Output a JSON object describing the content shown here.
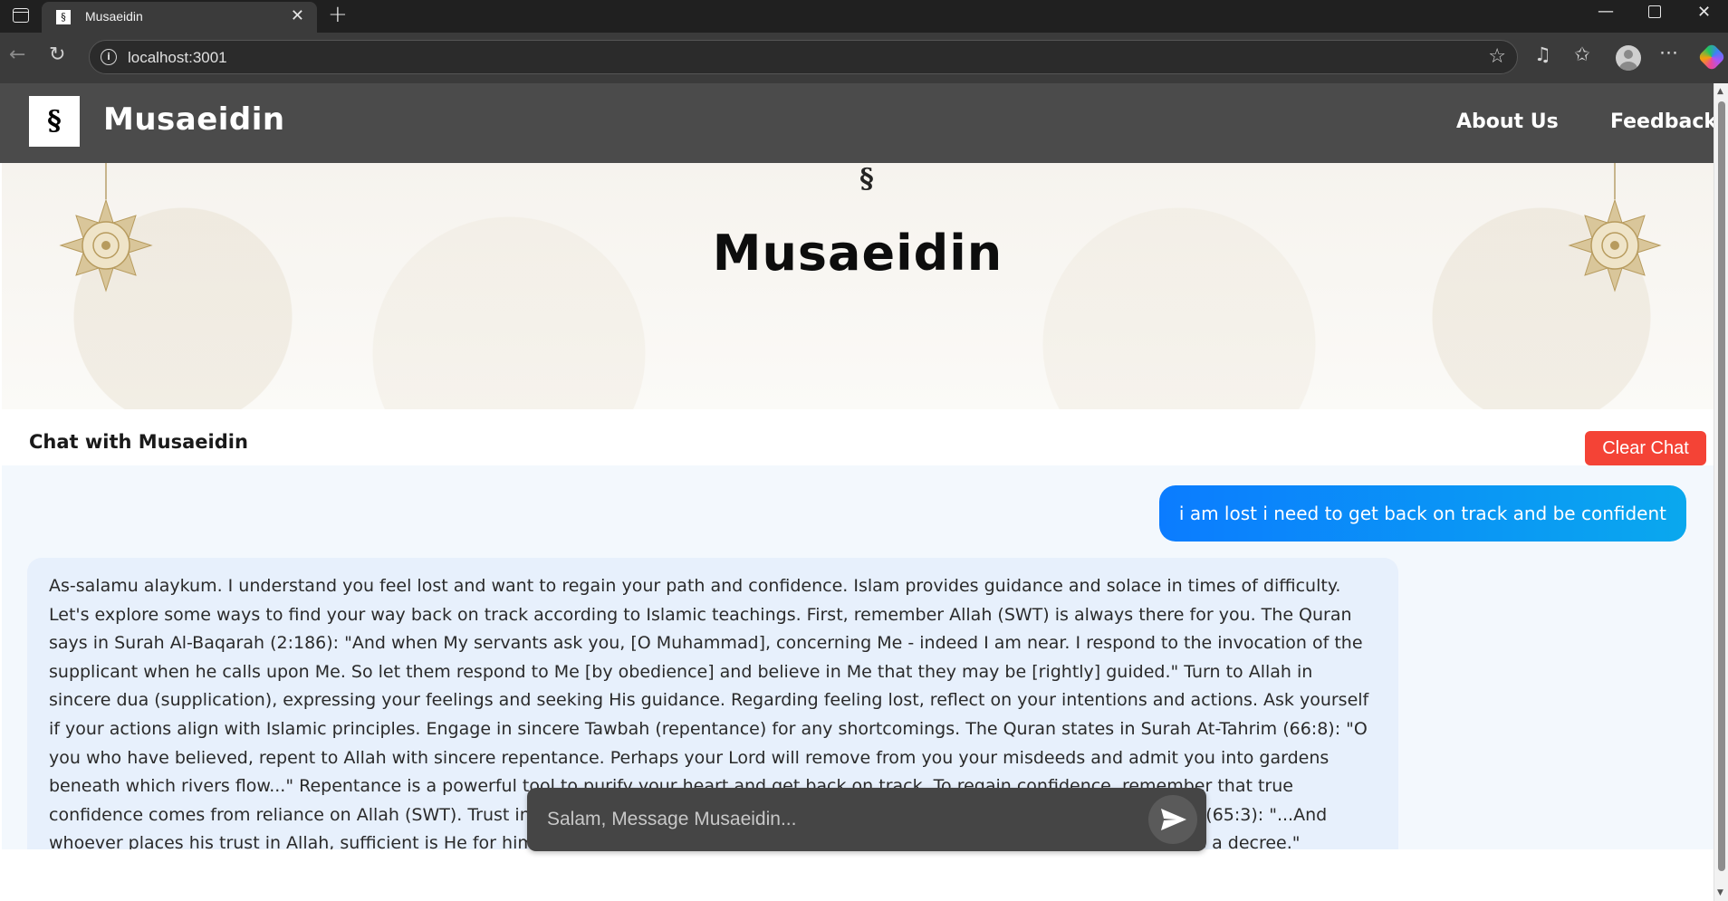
{
  "browser": {
    "tab_title": "Musaeidin",
    "tab_favicon": "§",
    "url": "localhost:3001"
  },
  "site": {
    "logo_glyph": "§",
    "brand": "Musaeidin",
    "nav": {
      "about": "About Us",
      "feedback": "Feedback"
    },
    "hero_title": "Musaeidin"
  },
  "chat": {
    "title": "Chat with Musaeidin",
    "clear_label": "Clear Chat",
    "messages": [
      {
        "role": "user",
        "text": "i am lost i need to get back on track and be confident"
      },
      {
        "role": "assistant",
        "text": "As-salamu alaykum. I understand you feel lost and want to regain your path and confidence. Islam provides guidance and solace in times of difficulty. Let's explore some ways to find your way back on track according to Islamic teachings. First, remember Allah (SWT) is always there for you. The Quran says in Surah Al-Baqarah (2:186): \"And when My servants ask you, [O Muhammad], concerning Me - indeed I am near. I respond to the invocation of the supplicant when he calls upon Me. So let them respond to Me [by obedience] and believe in Me that they may be [rightly] guided.\" Turn to Allah in sincere dua (supplication), expressing your feelings and seeking His guidance. Regarding feeling lost, reflect on your intentions and actions. Ask yourself if your actions align with Islamic principles. Engage in sincere Tawbah (repentance) for any shortcomings. The Quran states in Surah At-Tahrim (66:8): \"O you who have believed, repent to Allah with sincere repentance. Perhaps your Lord will remove from you your misdeeds and admit you into gardens beneath which rivers flow...\" Repentance is a powerful tool to purify your heart and get back on track. To regain confidence, remember that true confidence comes from reliance on Allah (SWT). Trust in His plan and believe that He will guide you. The Quran says in Surah At-Talaq (65:3): \"...And whoever places his trust in Allah, sufficient is He for him. Indeed, Allah will accomplish His purpose. Allah has already set for all things a decree.\" Furthermore, striving to improve yourself according to Islamic teachings can"
      }
    ],
    "input_placeholder": "Salam, Message Musaeidin..."
  },
  "colors": {
    "navbar": "#4b4b4b",
    "clear_button": "#f44336",
    "user_bubble_start": "#0b7cff",
    "user_bubble_end": "#0aa8ee",
    "assistant_bubble": "#e7f0fc",
    "composer": "#454545"
  },
  "icons": {
    "browser": [
      "window-icon",
      "close-icon",
      "plus-icon",
      "minimize-icon",
      "maximize-icon",
      "back-arrow-icon",
      "reload-icon",
      "info-icon",
      "star-icon",
      "music-icon",
      "favorites-icon",
      "profile-icon",
      "more-icon",
      "copilot-icon"
    ],
    "page": [
      "logo-icon",
      "lantern-icon",
      "send-icon"
    ]
  }
}
